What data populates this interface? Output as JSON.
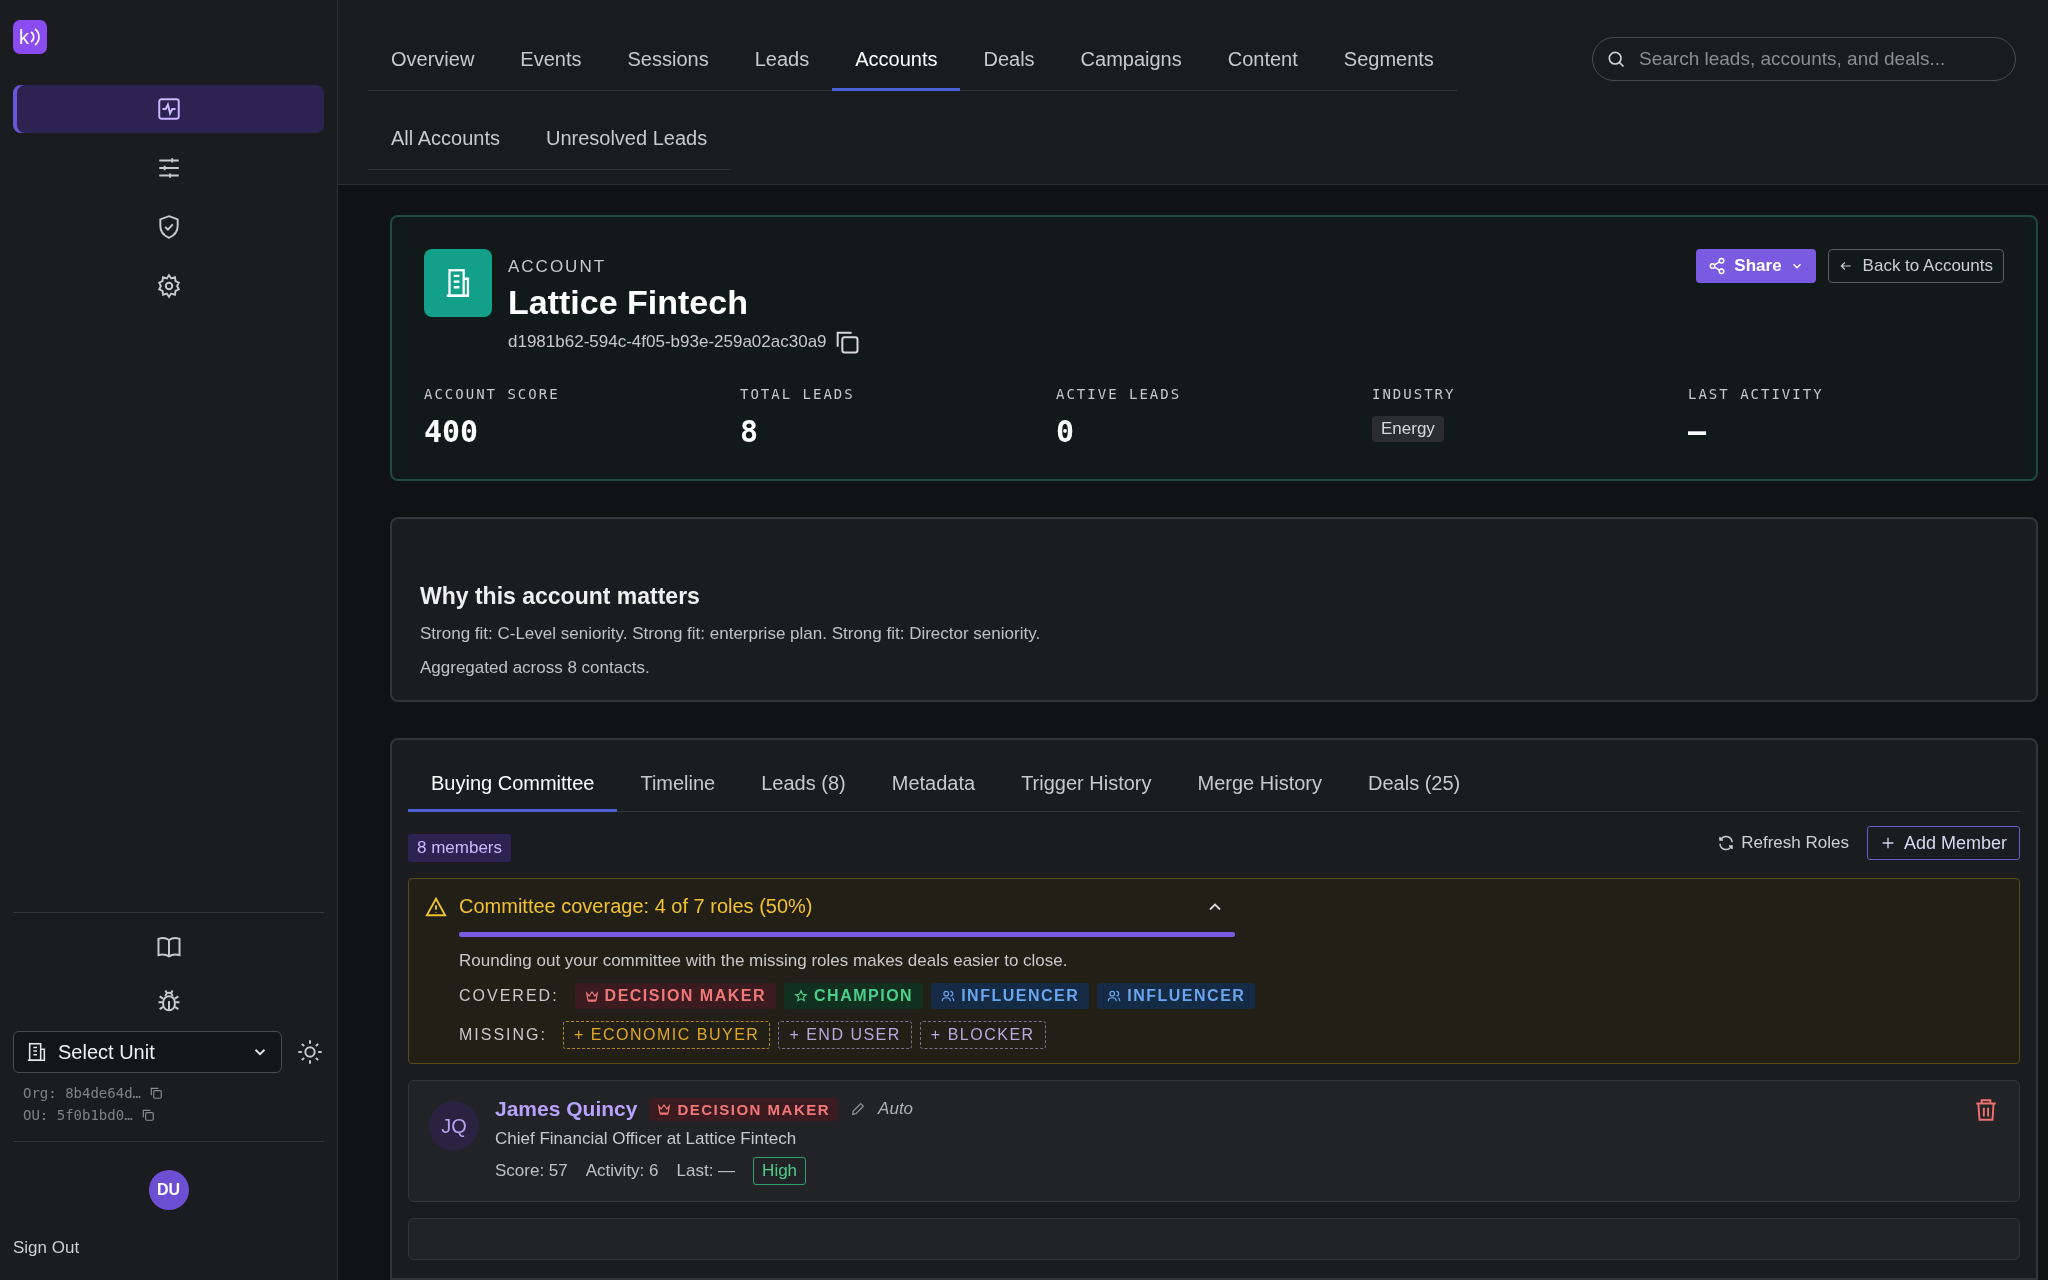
{
  "sidebar": {
    "logo": "k",
    "nav": [
      {
        "kind": "activity",
        "selected": true
      },
      {
        "kind": "sliders",
        "selected": false
      },
      {
        "kind": "shield",
        "selected": false
      },
      {
        "kind": "gear",
        "selected": false
      }
    ],
    "tools": [
      {
        "kind": "book"
      },
      {
        "kind": "bug"
      }
    ],
    "unit_select": {
      "value": "Select Unit"
    },
    "org": "Org: 8b4de64d…",
    "ou": "OU: 5f0b1bd0…",
    "avatar": "DU",
    "sign_out": "Sign Out"
  },
  "tabs": [
    {
      "label": "Overview",
      "selected": false
    },
    {
      "label": "Events",
      "selected": false
    },
    {
      "label": "Sessions",
      "selected": false
    },
    {
      "label": "Leads",
      "selected": false
    },
    {
      "label": "Accounts",
      "selected": true
    },
    {
      "label": "Deals",
      "selected": false
    },
    {
      "label": "Campaigns",
      "selected": false
    },
    {
      "label": "Content",
      "selected": false
    },
    {
      "label": "Segments",
      "selected": false
    }
  ],
  "search": {
    "placeholder": "Search leads, accounts, and deals..."
  },
  "subtabs": [
    {
      "label": "All Accounts",
      "selected": false
    },
    {
      "label": "Unresolved Leads",
      "selected": false
    }
  ],
  "account": {
    "eyebrow": "ACCOUNT",
    "name": "Lattice Fintech",
    "id": "d1981b62-594c-4f05-b93e-259a02ac30a9",
    "share": "Share",
    "back": "Back to Accounts",
    "stats": [
      {
        "label": "ACCOUNT SCORE",
        "value": "400",
        "kind": "number"
      },
      {
        "label": "TOTAL LEADS",
        "value": "8",
        "kind": "number"
      },
      {
        "label": "ACTIVE LEADS",
        "value": "0",
        "kind": "number"
      },
      {
        "label": "INDUSTRY",
        "value": "Energy",
        "kind": "tag"
      },
      {
        "label": "LAST ACTIVITY",
        "value": "—",
        "kind": "number"
      }
    ]
  },
  "why": {
    "title": "Why this account matters",
    "lines": [
      "Strong fit: C-Level seniority. Strong fit: enterprise plan. Strong fit: Director seniority.",
      "Aggregated across 8 contacts."
    ]
  },
  "committee": {
    "tabs": [
      {
        "label": "Buying Committee",
        "selected": true
      },
      {
        "label": "Timeline",
        "selected": false
      },
      {
        "label": "Leads (8)",
        "selected": false
      },
      {
        "label": "Metadata",
        "selected": false
      },
      {
        "label": "Trigger History",
        "selected": false
      },
      {
        "label": "Merge History",
        "selected": false
      },
      {
        "label": "Deals (25)",
        "selected": false
      }
    ],
    "members_badge": "8 members",
    "refresh": "Refresh Roles",
    "add": "Add Member",
    "coverage": {
      "title": "Committee coverage: 4 of 7 roles (50%)",
      "expanded": true,
      "level": 1.0,
      "description": "Rounding out your committee with the missing roles makes deals easier to close.",
      "covered_label": "COVERED:",
      "covered": [
        {
          "label": "DECISION MAKER",
          "kind": "decision"
        },
        {
          "label": "CHAMPION",
          "kind": "champion"
        },
        {
          "label": "INFLUENCER",
          "kind": "influencer"
        },
        {
          "label": "INFLUENCER",
          "kind": "influencer"
        }
      ],
      "missing_label": "MISSING:",
      "missing": [
        {
          "label": "+ ECONOMIC BUYER",
          "kind": "economic"
        },
        {
          "label": "+ END USER",
          "kind": "other"
        },
        {
          "label": "+ BLOCKER",
          "kind": "other"
        }
      ]
    },
    "members": [
      {
        "initials": "JQ",
        "name": "James Quincy",
        "role": {
          "label": "DECISION MAKER",
          "kind": "decision"
        },
        "source": "Auto",
        "title": "Chief Financial Officer at Lattice Fintech",
        "score": "Score: 57",
        "activity": "Activity: 6",
        "last": "Last: —",
        "priority": "High"
      }
    ]
  }
}
